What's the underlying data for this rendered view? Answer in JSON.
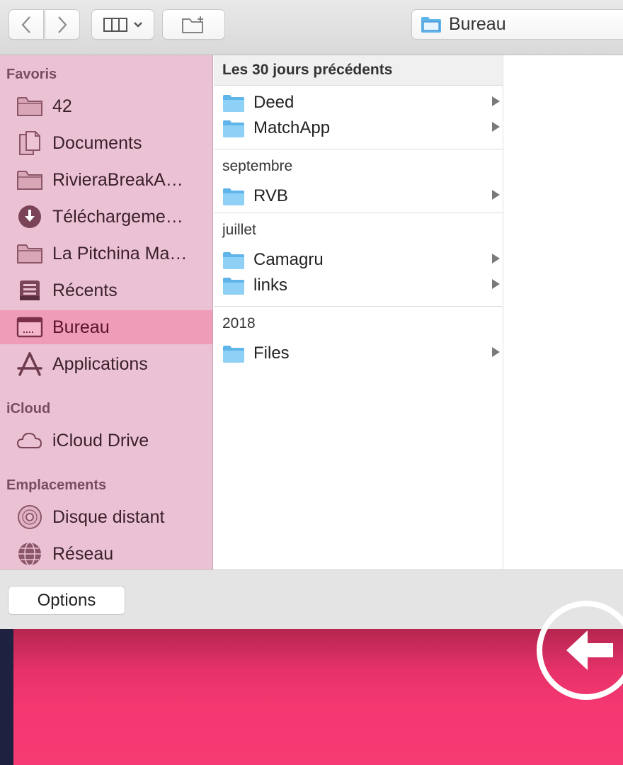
{
  "toolbar": {
    "back_icon": "chevron-left-icon",
    "forward_icon": "chevron-right-icon",
    "view_icon": "columns-view-icon",
    "new_folder_icon": "new-folder-icon",
    "path_label": "Bureau"
  },
  "sidebar": {
    "sections": [
      {
        "title": "Favoris"
      },
      {
        "title": "iCloud"
      },
      {
        "title": "Emplacements"
      }
    ],
    "items": [
      {
        "label": "42",
        "icon": "folder-icon"
      },
      {
        "label": "Documents",
        "icon": "documents-icon"
      },
      {
        "label": "RivieraBreakA…",
        "icon": "folder-icon"
      },
      {
        "label": "Téléchargeme…",
        "icon": "download-icon"
      },
      {
        "label": "La Pitchina Ma…",
        "icon": "folder-icon"
      },
      {
        "label": "Récents",
        "icon": "recents-icon"
      },
      {
        "label": "Bureau",
        "icon": "desktop-icon",
        "selected": true
      },
      {
        "label": "Applications",
        "icon": "applications-icon"
      },
      {
        "label": "iCloud Drive",
        "icon": "cloud-icon"
      },
      {
        "label": "Disque distant",
        "icon": "disc-icon"
      },
      {
        "label": "Réseau",
        "icon": "network-icon"
      }
    ]
  },
  "browser": {
    "groups": [
      {
        "title": "Les 30 jours précédents",
        "items": [
          "Deed",
          "MatchApp"
        ]
      },
      {
        "title": "septembre",
        "items": [
          "RVB"
        ]
      },
      {
        "title": "juillet",
        "items": [
          "Camagru",
          "links"
        ]
      },
      {
        "title": "2018",
        "items": [
          "Files"
        ]
      }
    ]
  },
  "footer": {
    "options_label": "Options"
  },
  "colors": {
    "sidebar_bg": "#ebc2d4",
    "sidebar_selected": "#ee9cb7",
    "folder_blue": "#7cc8f2",
    "app_bg_pink": "#f63a73"
  }
}
